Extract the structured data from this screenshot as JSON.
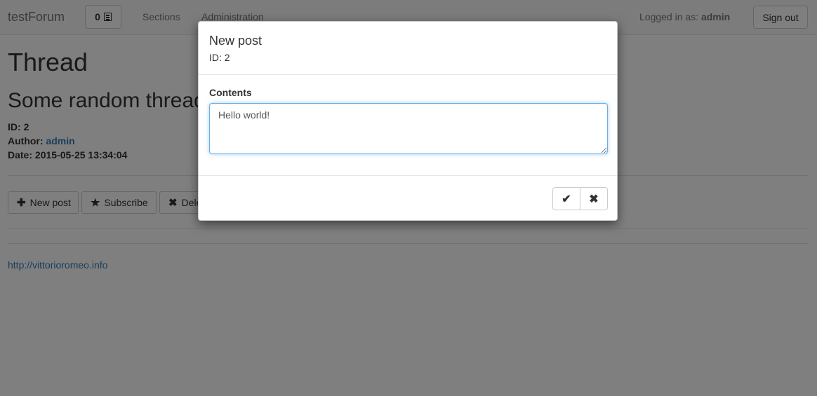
{
  "navbar": {
    "brand": "testForum",
    "notification_count": "0",
    "links": [
      "Sections",
      "Administration"
    ],
    "logged_in_prefix": "Logged in as:",
    "username": "admin",
    "sign_out_label": "Sign out"
  },
  "page": {
    "title": "Thread",
    "thread_title": "Some random thread",
    "id_label": "ID:",
    "id_value": "2",
    "author_label": "Author:",
    "author_value": "admin",
    "date_label": "Date:",
    "date_value": "2015-05-25 13:34:04",
    "actions": {
      "new_post": "New post",
      "subscribe": "Subscribe",
      "delete": "Delete"
    },
    "footer_link": "http://vittorioromeo.info"
  },
  "modal": {
    "title": "New post",
    "subtitle": "ID: 2",
    "field_label": "Contents",
    "contents_value": "Hello world!"
  },
  "icons": {
    "notification": "list-icon",
    "new_post": "plus-icon",
    "subscribe": "star-icon",
    "delete": "times-icon",
    "confirm": "check-icon",
    "cancel": "times-icon"
  },
  "colors": {
    "link": "#337ab7",
    "focus_border": "#66afe9",
    "backdrop": "rgba(0,0,0,0.5)"
  }
}
